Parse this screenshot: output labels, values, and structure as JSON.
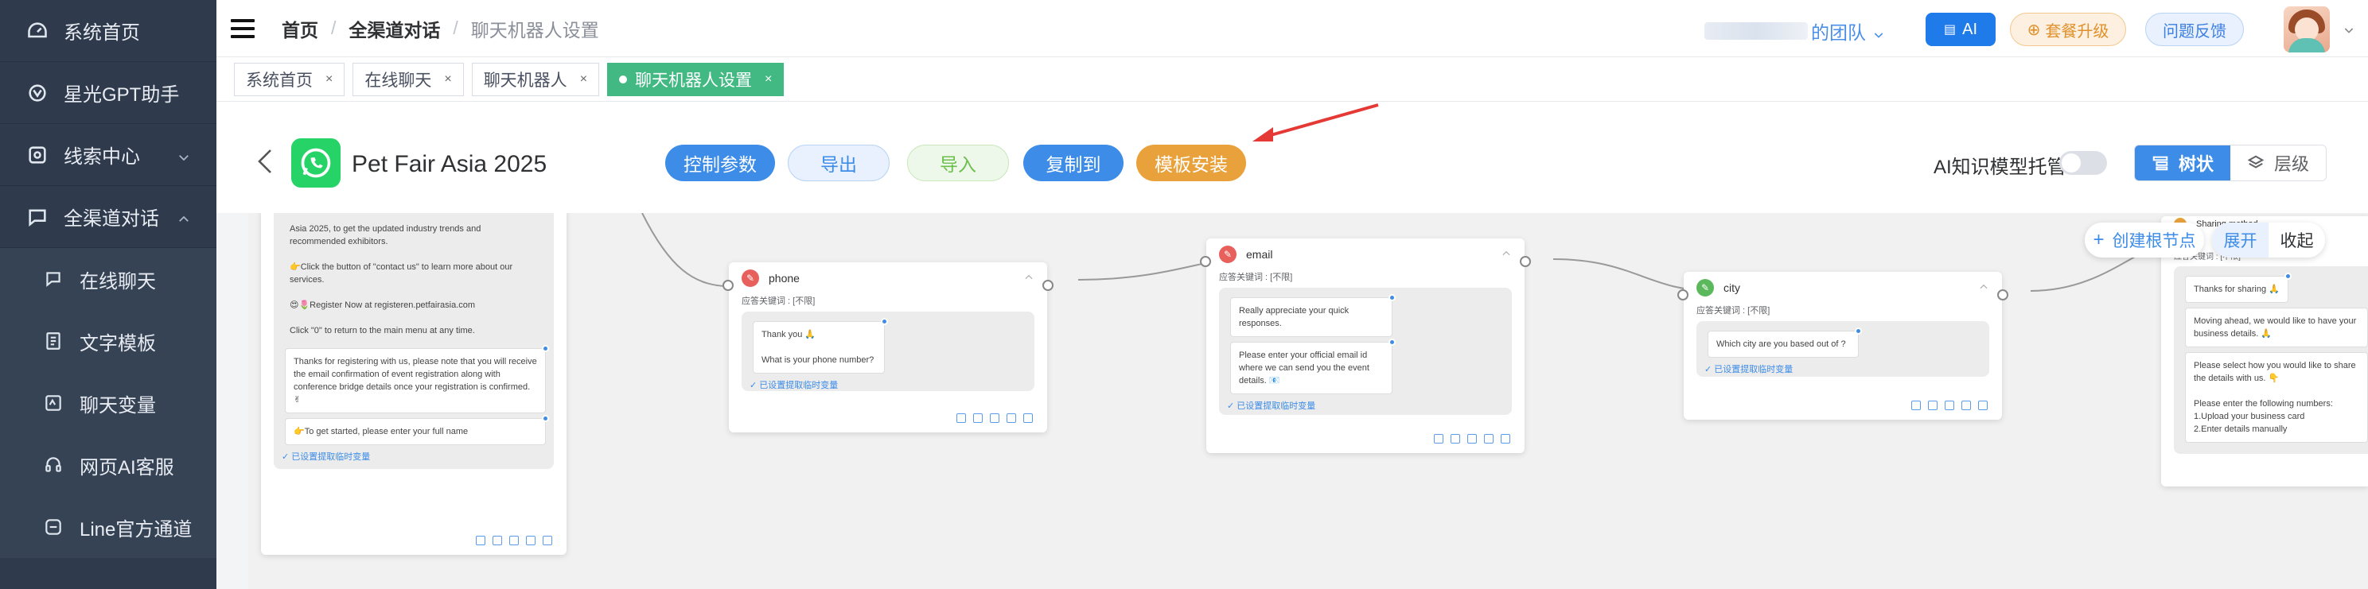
{
  "sidebar": {
    "items": [
      {
        "label": "系统首页",
        "icon": "dashboard-icon"
      },
      {
        "label": "星光GPT助手",
        "icon": "gpt-icon"
      },
      {
        "label": "线索中心",
        "icon": "leads-icon",
        "expandable": true
      },
      {
        "label": "全渠道对话",
        "icon": "chat-icon",
        "expanded": true
      }
    ],
    "sub_items": [
      {
        "label": "在线聊天",
        "icon": "chat-bubble-icon"
      },
      {
        "label": "文字模板",
        "icon": "template-icon"
      },
      {
        "label": "聊天变量",
        "icon": "variable-icon"
      },
      {
        "label": "网页AI客服",
        "icon": "headset-icon"
      },
      {
        "label": "Line官方通道",
        "icon": "line-icon"
      }
    ]
  },
  "header": {
    "breadcrumb": [
      "首页",
      "全渠道对话",
      "聊天机器人设置"
    ],
    "team_label": "的团队",
    "ai_button": "AI",
    "upgrade_button": "套餐升级",
    "feedback_button": "问题反馈"
  },
  "tabs": [
    {
      "label": "系统首页",
      "active": false
    },
    {
      "label": "在线聊天",
      "active": false
    },
    {
      "label": "聊天机器人",
      "active": false
    },
    {
      "label": "聊天机器人设置",
      "active": true
    }
  ],
  "toolbar": {
    "bot_name": "Pet Fair Asia 2025",
    "control_params": "控制参数",
    "export": "导出",
    "import": "导入",
    "copy_to": "复制到",
    "template_install": "模板安装",
    "ai_hosting_label": "AI知识模型托管",
    "ai_hosting_on": false,
    "view_tree": "树状",
    "view_level": "层级"
  },
  "canvas": {
    "create_root": "创建根节点",
    "expand": "展开",
    "collapse": "收起",
    "node0": {
      "bubble1": "Asia 2025, to get the updated industry trends and recommended exhibitors.\n\n👉Click the button of \"contact us\" to learn more about our services.\n\n😍🌷Register Now at registeren.petfairasia.com\n\nClick \"0\" to return to the main menu at any time.",
      "bubble2": "Thanks for registering with us, please note that you will receive the email confirmation of event registration along with conference bridge details once your registration is confirmed. ✌",
      "bubble3": "👉To get started, please enter your full name",
      "var_link": "已设置提取临时变量"
    },
    "phone": {
      "title": "phone",
      "keyword": "应答关键词 : [不限]",
      "bubble": "Thank you 🙏\n\nWhat is your phone number?",
      "var_link": "已设置提取临时变量"
    },
    "email": {
      "title": "email",
      "keyword": "应答关键词 : [不限]",
      "bubble1": "Really appreciate your quick responses.",
      "bubble2": "Please enter your official email id where we can send you the event details. 📧",
      "var_link": "已设置提取临时变量"
    },
    "city": {
      "title": "city",
      "keyword": "应答关键词 : [不限]",
      "bubble": "Which city are you based out of ?",
      "var_link": "已设置提取临时变量"
    },
    "sharing": {
      "title": "Sharing method",
      "keyword": "应答关键词 : [不限]",
      "bubble1": "Thanks for sharing 🙏",
      "bubble2": "Moving ahead, we would like to have your business details. 🙏",
      "bubble3": "Please select how you would like to share the details with us. 👇\n\nPlease enter the following numbers:\n1.Upload your business card\n2.Enter details manually"
    }
  },
  "colors": {
    "sidebar_bg": "#2f3b4c",
    "primary": "#3d8ce8",
    "active_tab": "#42b983",
    "template_orange": "#e9a23b"
  }
}
